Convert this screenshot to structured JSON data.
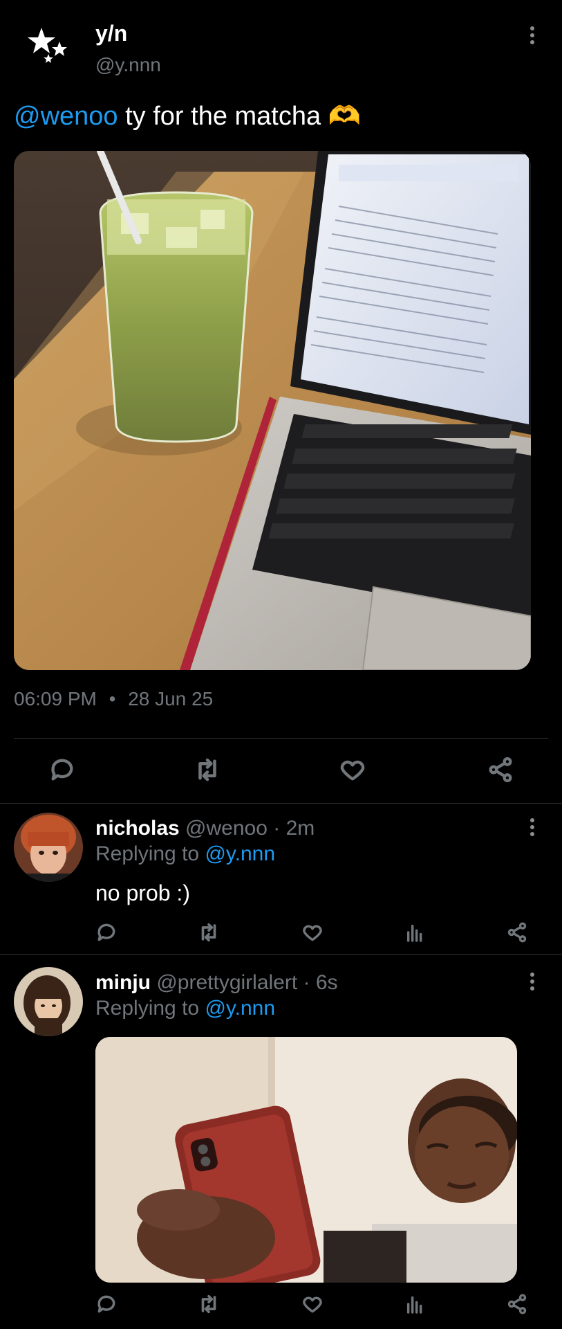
{
  "main_tweet": {
    "author_name": "y/n",
    "author_handle": "@y.nnn",
    "mention": "@wenoo",
    "text": " ty for the matcha ",
    "emoji": "🫶",
    "time": "06:09 PM",
    "separator": "•",
    "date": "28 Jun 25"
  },
  "replies": [
    {
      "name": "nicholas",
      "handle": "@wenoo",
      "meta": " · 2m",
      "replying_label": "Replying to ",
      "replying_to": "@y.nnn",
      "text": "no prob :)"
    },
    {
      "name": "minju",
      "handle": "@prettygirlalert",
      "meta": " · 6s",
      "replying_label": "Replying to ",
      "replying_to": "@y.nnn",
      "text": ""
    }
  ],
  "colors": {
    "background": "#000000",
    "link": "#1d9bf0",
    "muted": "#71767b",
    "divider": "#2f3336"
  },
  "icons": [
    "sparkle-stars-icon",
    "more-options-icon",
    "reply-icon",
    "retweet-icon",
    "like-icon",
    "views-icon",
    "share-icon"
  ]
}
